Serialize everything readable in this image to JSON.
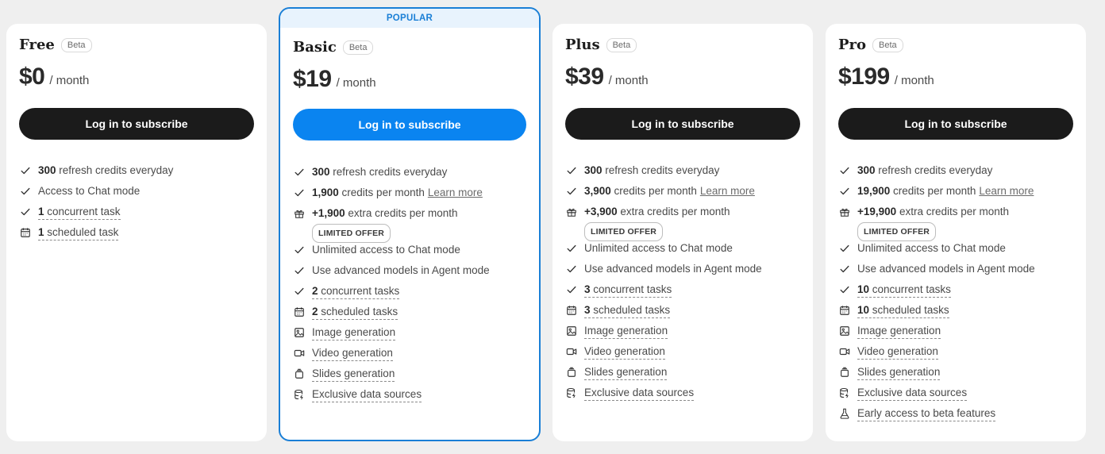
{
  "badge_label": "Beta",
  "popular_label": "POPULAR",
  "period_label": "/ month",
  "subscribe_label": "Log in to subscribe",
  "learn_more": "Learn more",
  "limited_offer": "LIMITED OFFER",
  "colors": {
    "accent": "#0a84f0",
    "popular_border": "#1a7fd6",
    "dark_button": "#1b1b1b"
  },
  "plans": [
    {
      "name": "Free",
      "price": "$0",
      "features": [
        {
          "icon": "check-icon",
          "num": "300",
          "text": " refresh credits everyday"
        },
        {
          "icon": "check-icon",
          "text": "Access to Chat mode"
        },
        {
          "icon": "check-icon",
          "num": "1",
          "text": " concurrent task"
        },
        {
          "icon": "calendar-icon",
          "num": "1",
          "text": " scheduled task"
        }
      ]
    },
    {
      "name": "Basic",
      "price": "$19",
      "features": [
        {
          "icon": "check-icon",
          "num": "300",
          "text": " refresh credits everyday"
        },
        {
          "icon": "check-icon",
          "num": "1,900",
          "text": " credits per month"
        },
        {
          "icon": "gift-icon",
          "num": "+1,900",
          "text": " extra credits per month"
        },
        {
          "icon": "check-icon",
          "text": "Unlimited access to Chat mode"
        },
        {
          "icon": "check-icon",
          "text": "Use advanced models in Agent mode"
        },
        {
          "icon": "check-icon",
          "num": "2",
          "text": " concurrent tasks"
        },
        {
          "icon": "calendar-icon",
          "num": "2",
          "text": " scheduled tasks"
        },
        {
          "icon": "image-icon",
          "text": "Image generation"
        },
        {
          "icon": "video-icon",
          "text": "Video generation"
        },
        {
          "icon": "slides-icon",
          "text": "Slides generation"
        },
        {
          "icon": "database-icon",
          "text": "Exclusive data sources"
        }
      ]
    },
    {
      "name": "Plus",
      "price": "$39",
      "features": [
        {
          "icon": "check-icon",
          "num": "300",
          "text": " refresh credits everyday"
        },
        {
          "icon": "check-icon",
          "num": "3,900",
          "text": " credits per month"
        },
        {
          "icon": "gift-icon",
          "num": "+3,900",
          "text": " extra credits per month"
        },
        {
          "icon": "check-icon",
          "text": "Unlimited access to Chat mode"
        },
        {
          "icon": "check-icon",
          "text": "Use advanced models in Agent mode"
        },
        {
          "icon": "check-icon",
          "num": "3",
          "text": " concurrent tasks"
        },
        {
          "icon": "calendar-icon",
          "num": "3",
          "text": " scheduled tasks"
        },
        {
          "icon": "image-icon",
          "text": "Image generation"
        },
        {
          "icon": "video-icon",
          "text": "Video generation"
        },
        {
          "icon": "slides-icon",
          "text": "Slides generation"
        },
        {
          "icon": "database-icon",
          "text": "Exclusive data sources"
        }
      ]
    },
    {
      "name": "Pro",
      "price": "$199",
      "features": [
        {
          "icon": "check-icon",
          "num": "300",
          "text": " refresh credits everyday"
        },
        {
          "icon": "check-icon",
          "num": "19,900",
          "text": " credits per month"
        },
        {
          "icon": "gift-icon",
          "num": "+19,900",
          "text": " extra credits per month"
        },
        {
          "icon": "check-icon",
          "text": "Unlimited access to Chat mode"
        },
        {
          "icon": "check-icon",
          "text": "Use advanced models in Agent mode"
        },
        {
          "icon": "check-icon",
          "num": "10",
          "text": " concurrent tasks"
        },
        {
          "icon": "calendar-icon",
          "num": "10",
          "text": " scheduled tasks"
        },
        {
          "icon": "image-icon",
          "text": "Image generation"
        },
        {
          "icon": "video-icon",
          "text": "Video generation"
        },
        {
          "icon": "slides-icon",
          "text": "Slides generation"
        },
        {
          "icon": "database-icon",
          "text": "Exclusive data sources"
        },
        {
          "icon": "flask-icon",
          "text": "Early access to beta features"
        }
      ]
    }
  ]
}
